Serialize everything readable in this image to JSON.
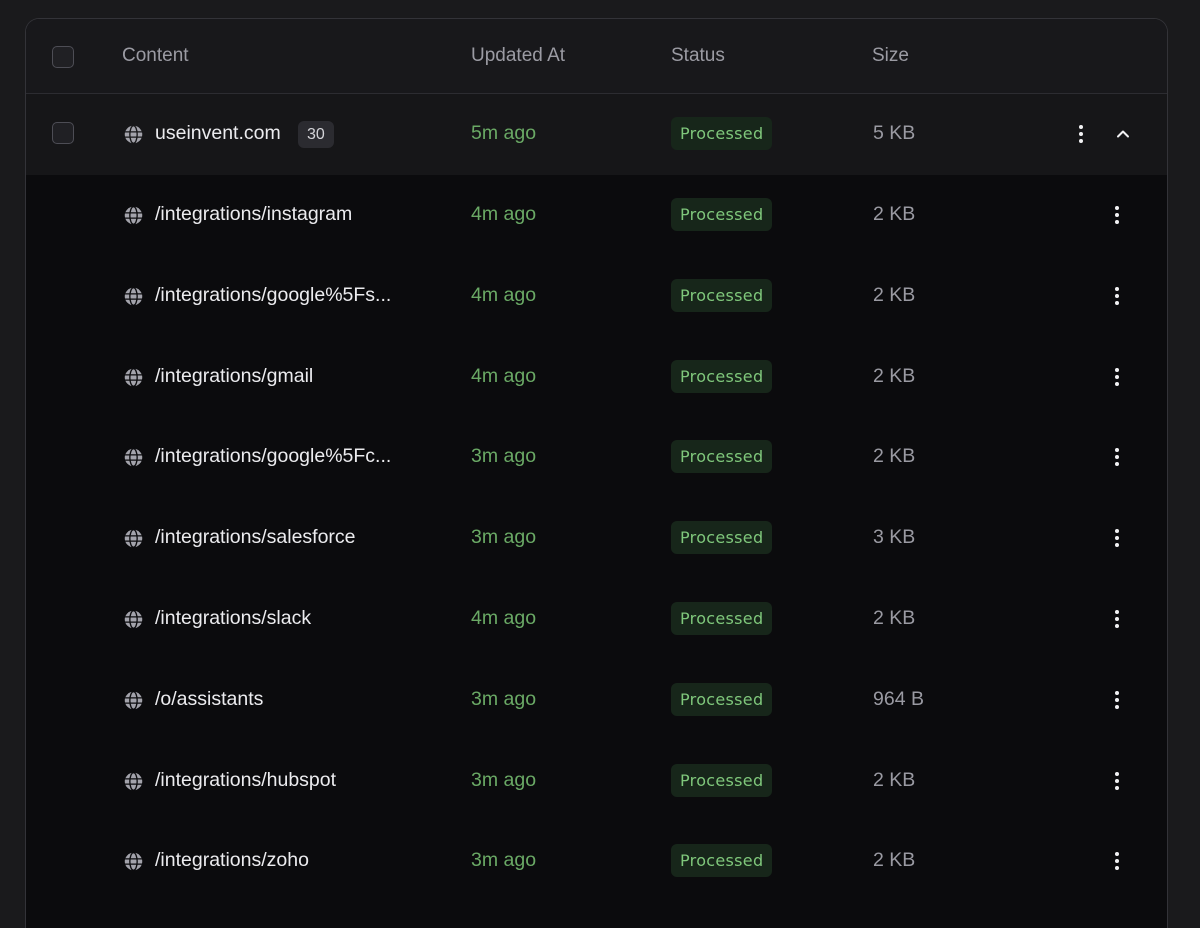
{
  "columns": {
    "content": "Content",
    "updated_at": "Updated At",
    "status": "Status",
    "size": "Size"
  },
  "parent": {
    "name": "useinvent.com",
    "count": "30",
    "updated": "5m ago",
    "status": "Processed",
    "size": "5 KB"
  },
  "rows": [
    {
      "name": "/integrations/instagram",
      "updated": "4m ago",
      "status": "Processed",
      "size": "2 KB"
    },
    {
      "name": "/integrations/google%5Fs...",
      "updated": "4m ago",
      "status": "Processed",
      "size": "2 KB"
    },
    {
      "name": "/integrations/gmail",
      "updated": "4m ago",
      "status": "Processed",
      "size": "2 KB"
    },
    {
      "name": "/integrations/google%5Fc...",
      "updated": "3m ago",
      "status": "Processed",
      "size": "2 KB"
    },
    {
      "name": "/integrations/salesforce",
      "updated": "3m ago",
      "status": "Processed",
      "size": "3 KB"
    },
    {
      "name": "/integrations/slack",
      "updated": "4m ago",
      "status": "Processed",
      "size": "2 KB"
    },
    {
      "name": "/o/assistants",
      "updated": "3m ago",
      "status": "Processed",
      "size": "964 B"
    },
    {
      "name": "/integrations/hubspot",
      "updated": "3m ago",
      "status": "Processed",
      "size": "2 KB"
    },
    {
      "name": "/integrations/zoho",
      "updated": "3m ago",
      "status": "Processed",
      "size": "2 KB"
    }
  ],
  "icons": {
    "row_icon": "globe-icon",
    "menu_icon": "more-vertical-icon",
    "collapse_icon": "chevron-up-icon"
  },
  "colors": {
    "status_text": "#7fc77b",
    "status_bg": "#17261a",
    "time_text": "#6aa965"
  }
}
